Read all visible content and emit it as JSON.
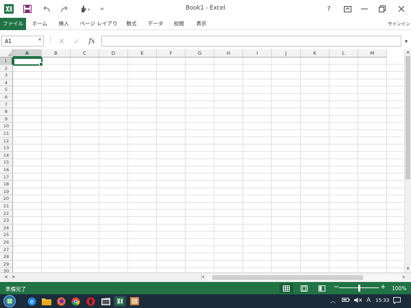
{
  "window": {
    "title": "Book1 - Excel",
    "help_label": "?",
    "signin_label": "サインイン"
  },
  "colors": {
    "excel_green": "#217346",
    "taskbar": "#1b2b3a"
  },
  "quick_access": {
    "icons": [
      "excel-app-icon",
      "save-icon",
      "undo-icon",
      "redo-icon",
      "touch-mode-icon",
      "customize-qat-icon"
    ]
  },
  "ribbon": {
    "tabs": [
      "ファイル",
      "ホーム",
      "挿入",
      "ページ レイアウト",
      "数式",
      "データ",
      "校閲",
      "表示"
    ]
  },
  "formula_bar": {
    "name_box": "A1",
    "formula_value": "",
    "fx_label": "fx"
  },
  "grid": {
    "columns": [
      "A",
      "B",
      "C",
      "D",
      "E",
      "F",
      "G",
      "H",
      "I",
      "J",
      "K",
      "L",
      "M"
    ],
    "rows": [
      "1",
      "2",
      "3",
      "4",
      "5",
      "6",
      "7",
      "8",
      "9",
      "10",
      "11",
      "12",
      "13",
      "14",
      "15",
      "16",
      "17",
      "18",
      "19",
      "20",
      "21",
      "22",
      "23",
      "24",
      "25",
      "26",
      "27",
      "28",
      "29",
      "30"
    ],
    "active_cell": "A1"
  },
  "status": {
    "ready": "準備完了",
    "zoom": "100%",
    "zoom_level": 1.0
  },
  "taskbar": {
    "apps": [
      "edge-icon",
      "file-explorer-icon",
      "firefox-icon",
      "chrome-icon",
      "opera-icon",
      "media-icon",
      "excel-taskbar-icon",
      "app-icon"
    ],
    "ime": "A",
    "time": "15:33"
  }
}
